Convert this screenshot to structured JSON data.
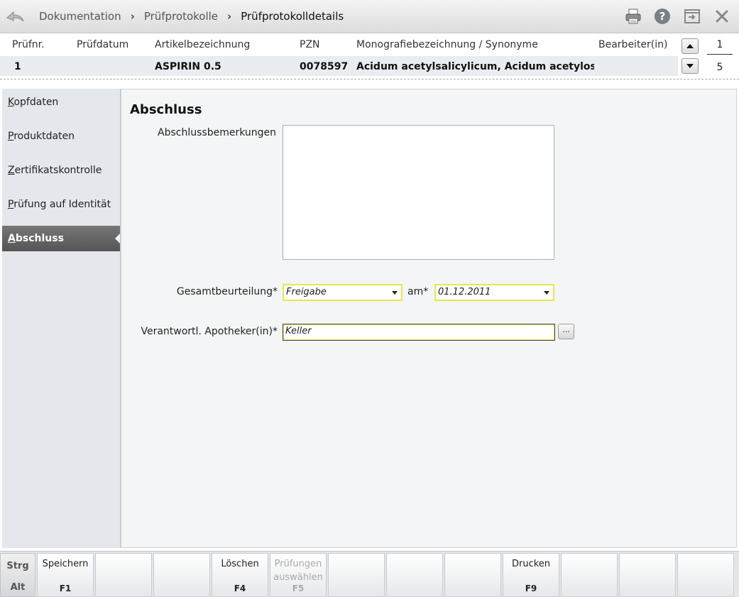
{
  "breadcrumb": {
    "items": [
      "Dokumentation",
      "Prüfprotokolle",
      "Prüfprotokolldetails"
    ]
  },
  "toolbar": {
    "icons": [
      "back-arrow-icon",
      "printer-icon",
      "help-icon",
      "window-switch-icon",
      "close-icon"
    ]
  },
  "header": {
    "columns": {
      "pruefnr": "Prüfnr.",
      "pruefdatum": "Prüfdatum",
      "artikel": "Artikelbezeichnung",
      "pzn": "PZN",
      "monografie": "Monografiebezeichnung / Synonyme",
      "bearbeiter": "Bearbeiter(in)"
    },
    "row": {
      "pruefnr": "1",
      "pruefdatum": "",
      "artikel": "ASPIRIN 0.5",
      "pzn": "0078597",
      "monografie": "Acidum acetylsalicylicum, Acidum acetylosalicylicum",
      "bearbeiter": ""
    },
    "page_current": "1",
    "page_total": "5"
  },
  "sidebar": {
    "items": [
      {
        "first": "K",
        "rest": "opfdaten"
      },
      {
        "first": "P",
        "rest": "roduktdaten"
      },
      {
        "first": "Z",
        "rest": "ertifikatskontrolle"
      },
      {
        "first": "P",
        "rest": "rüfung auf Identität"
      },
      {
        "first": "A",
        "rest": "bschluss"
      }
    ],
    "active_index": 4
  },
  "form": {
    "title": "Abschluss",
    "remarks_label": "Abschlussbemerkungen",
    "remarks_value": "",
    "rating_label": "Gesamtbeurteilung*",
    "rating_value": "Freigabe",
    "date_label": "am*",
    "date_value": "01.12.2011",
    "pharmacist_label": "Verantwortl. Apotheker(in)*",
    "pharmacist_value": "Keller",
    "browse_label": "..."
  },
  "fkeys": {
    "mod_top": "Strg",
    "mod_bottom": "Alt",
    "keys": [
      {
        "label": "Speichern",
        "key": "F1",
        "enabled": true
      },
      {
        "label": "",
        "key": "",
        "enabled": true
      },
      {
        "label": "",
        "key": "",
        "enabled": true
      },
      {
        "label": "Löschen",
        "key": "F4",
        "enabled": true
      },
      {
        "label": "Prüfungen auswählen",
        "key": "F5",
        "enabled": false
      },
      {
        "label": "",
        "key": "",
        "enabled": true
      },
      {
        "label": "",
        "key": "",
        "enabled": true
      },
      {
        "label": "",
        "key": "",
        "enabled": true
      },
      {
        "label": "Drucken",
        "key": "F9",
        "enabled": true
      },
      {
        "label": "",
        "key": "",
        "enabled": true
      },
      {
        "label": "",
        "key": "",
        "enabled": true
      },
      {
        "label": "",
        "key": "",
        "enabled": true
      }
    ]
  },
  "colors": {
    "active_nav": "#666666",
    "field_highlight": "#e6e84a"
  }
}
